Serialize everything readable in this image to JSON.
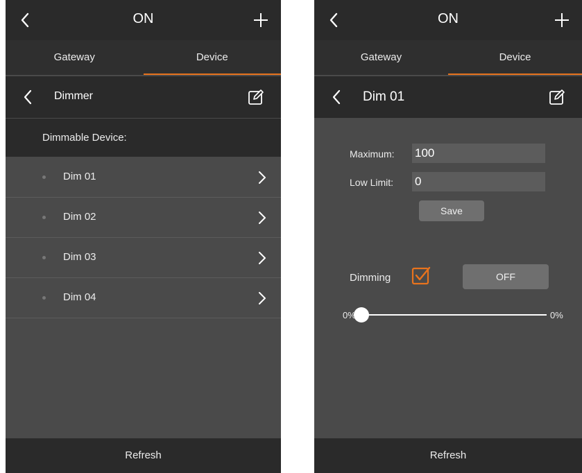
{
  "screens": {
    "left": {
      "header": {
        "title": "ON",
        "back_icon": "chevron-left-icon",
        "add_icon": "plus-icon"
      },
      "tabs": [
        {
          "label": "Gateway"
        },
        {
          "label": "Device",
          "active": true
        }
      ],
      "subheader": {
        "title": "Dimmer",
        "edit_icon": "edit-icon"
      },
      "section_label": "Dimmable Device:",
      "devices": [
        {
          "name": "Dim 01"
        },
        {
          "name": "Dim 02"
        },
        {
          "name": "Dim 03"
        },
        {
          "name": "Dim 04"
        }
      ],
      "refresh_label": "Refresh"
    },
    "right": {
      "header": {
        "title": "ON",
        "back_icon": "chevron-left-icon",
        "add_icon": "plus-icon"
      },
      "tabs": [
        {
          "label": "Gateway"
        },
        {
          "label": "Device",
          "active": true
        }
      ],
      "subheader": {
        "title": "Dim 01",
        "edit_icon": "edit-icon"
      },
      "form": {
        "maximum_label": "Maximum:",
        "maximum_value": "100",
        "low_limit_label": "Low Limit:",
        "low_limit_value": "0",
        "save_label": "Save"
      },
      "dimming": {
        "label": "Dimming",
        "checked": true,
        "toggle_label": "OFF"
      },
      "slider": {
        "min_label": "0%",
        "value_label": "0%",
        "value": 0
      },
      "refresh_label": "Refresh"
    }
  },
  "colors": {
    "accent": "#e8731d",
    "background": "#4a4a4a",
    "bar": "#2a2a2a"
  }
}
